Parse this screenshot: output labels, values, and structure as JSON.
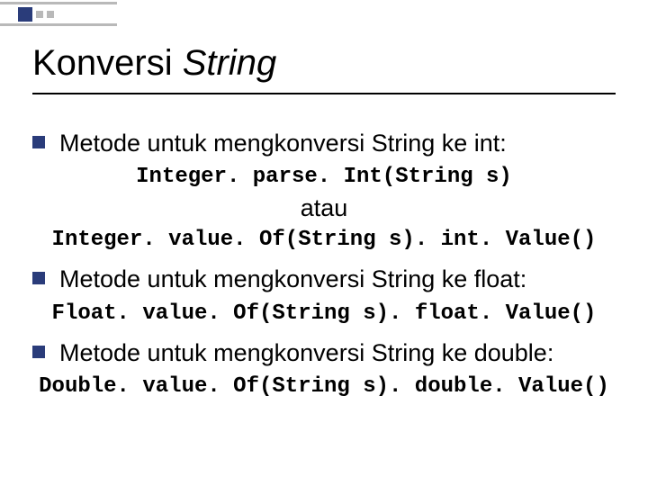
{
  "title": {
    "plain": "Konversi ",
    "italic": "String"
  },
  "bullets": [
    {
      "text": "Metode untuk mengkonversi String ke int:",
      "code1": "Integer. parse. Int(String s)",
      "mid": "atau",
      "code2": "Integer. value. Of(String s). int. Value()"
    },
    {
      "text": "Metode untuk mengkonversi String ke float:",
      "code1": "Float. value. Of(String s). float. Value()"
    },
    {
      "text": "Metode untuk mengkonversi String ke double:",
      "code1": "Double. value. Of(String s). double. Value()"
    }
  ]
}
